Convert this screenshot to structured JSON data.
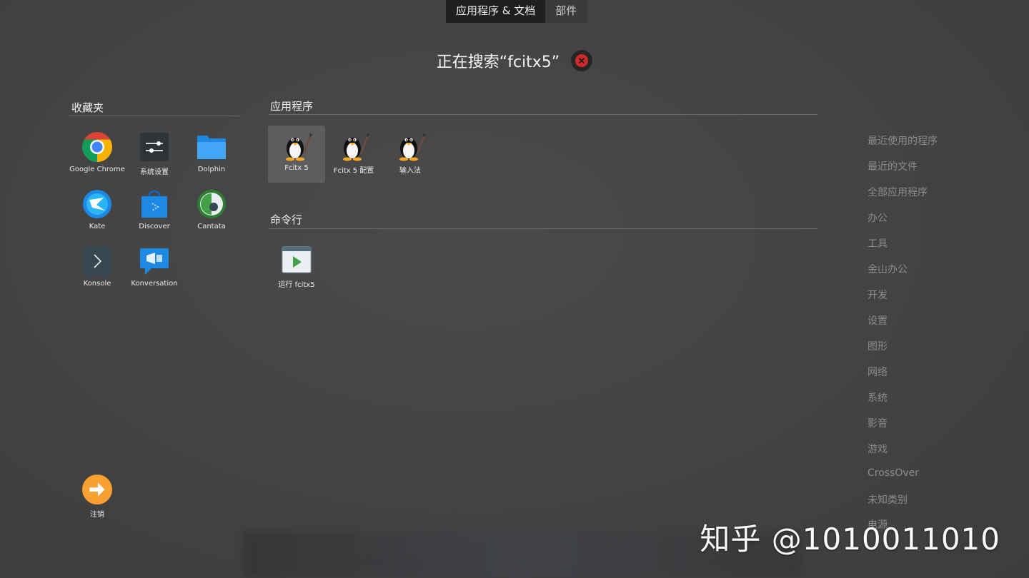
{
  "tabs": [
    {
      "label": "应用程序 & 文档"
    },
    {
      "label": "部件"
    }
  ],
  "search": {
    "title": "正在搜索“fcitx5”"
  },
  "favorites": {
    "title": "收藏夹",
    "items": [
      {
        "label": "Google Chrome",
        "icon": "chrome-icon"
      },
      {
        "label": "系统设置",
        "icon": "system-settings-icon"
      },
      {
        "label": "Dolphin",
        "icon": "folder-icon"
      },
      {
        "label": "Kate",
        "icon": "kate-icon"
      },
      {
        "label": "Discover",
        "icon": "discover-bag-icon"
      },
      {
        "label": "Cantata",
        "icon": "cantata-icon"
      },
      {
        "label": "Konsole",
        "icon": "terminal-icon"
      },
      {
        "label": "Konversation",
        "icon": "chat-icon"
      }
    ]
  },
  "apps": {
    "title": "应用程序",
    "items": [
      {
        "label": "Fcitx 5",
        "icon": "penguin-icon"
      },
      {
        "label": "Fcitx 5 配置",
        "icon": "penguin-icon"
      },
      {
        "label": "输入法",
        "icon": "penguin-icon"
      }
    ]
  },
  "commands": {
    "title": "命令行",
    "items": [
      {
        "label": "运行 fcitx5",
        "icon": "run-icon"
      }
    ]
  },
  "logout": {
    "label": "注销",
    "icon": "arrow-right-icon",
    "color": "#f7a132"
  },
  "categories": [
    "最近使用的程序",
    "最近的文件",
    "全部应用程序",
    "办公",
    "工具",
    "金山办公",
    "开发",
    "设置",
    "图形",
    "网络",
    "系统",
    "影音",
    "游戏",
    "CrossOver",
    "未知类别",
    "电源"
  ],
  "watermark": "知乎 @1010011010"
}
